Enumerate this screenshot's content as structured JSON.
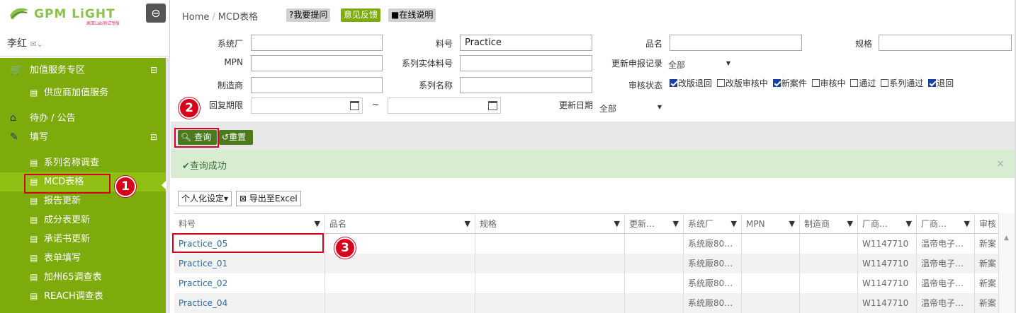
{
  "app": {
    "logo_text": "GPM LiGHT",
    "logo_sub": "高亚Lab测试专版",
    "user_name": "李红",
    "user_caret": "✉⌄"
  },
  "sidebar": {
    "groups": [
      {
        "label": "加值服务专区",
        "icon": "cart-icon",
        "toggle": "⊟"
      },
      {
        "label": "待办 / 公告",
        "icon": "home-icon"
      },
      {
        "label": "填写",
        "icon": "edit-icon",
        "toggle": "⊟"
      }
    ],
    "items_group1": [
      "供应商加值服务"
    ],
    "items_group3": [
      "系列名称调查",
      "MCD表格",
      "报告更新",
      "成分表更新",
      "承诺书更新",
      "表单填写",
      "加州65调查表",
      "REACH调查表"
    ]
  },
  "breadcrumb": {
    "home": "Home",
    "sep": "/",
    "current": "MCD表格"
  },
  "header_tags": {
    "ask": "?我要提问",
    "feedback": "意见反馈",
    "help": "■在线说明"
  },
  "form": {
    "labels": {
      "system_factory": "系统厂",
      "part_no": "料号",
      "product_name": "品名",
      "spec": "规格",
      "mpn": "MPN",
      "series_part": "系列实体料号",
      "update_record": "更新申报记录",
      "manufacturer": "制造商",
      "series_name": "系列名称",
      "review_status": "审核状态",
      "reply_deadline": "回复期限",
      "range_sep": "~",
      "update_date": "更新日期"
    },
    "values": {
      "part_no": "Practice",
      "update_record": "全部",
      "update_date": "全部"
    },
    "status_options": [
      {
        "label": "改版退回",
        "checked": true
      },
      {
        "label": "改版审核中",
        "checked": false
      },
      {
        "label": "新案件",
        "checked": true
      },
      {
        "label": "审核中",
        "checked": false
      },
      {
        "label": "通过",
        "checked": false
      },
      {
        "label": "系列通过",
        "checked": false
      },
      {
        "label": "退回",
        "checked": true
      }
    ]
  },
  "buttons": {
    "query": "查询",
    "reset": "重置",
    "personal": "个人化设定▾",
    "export": "导出至Excel"
  },
  "alert": {
    "text": "✔查询成功",
    "close": "×"
  },
  "steps": [
    "1",
    "2",
    "3"
  ],
  "table": {
    "columns": [
      "料号",
      "品名",
      "规格",
      "更新…",
      "系统厂",
      "MPN",
      "制造商",
      "厂商…",
      "厂商…",
      "审核"
    ],
    "rows": [
      [
        "Practice_05",
        "",
        "",
        "",
        "系统厰80…",
        "",
        "",
        "W1147710",
        "温帝电子…",
        "新案"
      ],
      [
        "Practice_01",
        "",
        "",
        "",
        "系统厰80…",
        "",
        "",
        "W1147710",
        "温帝电子…",
        "新案"
      ],
      [
        "Practice_02",
        "",
        "",
        "",
        "系统厰80…",
        "",
        "",
        "W1147710",
        "温帝电子…",
        "新案"
      ],
      [
        "Practice_04",
        "",
        "",
        "",
        "系统厰80…",
        "",
        "",
        "W1147710",
        "温帝电子…",
        "新案"
      ]
    ]
  },
  "colors": {
    "sidebar_green": "#7cab0b",
    "highlight_red": "#d9001b",
    "link_blue": "#2a6aa8",
    "button_green": "#4a7a1c"
  }
}
